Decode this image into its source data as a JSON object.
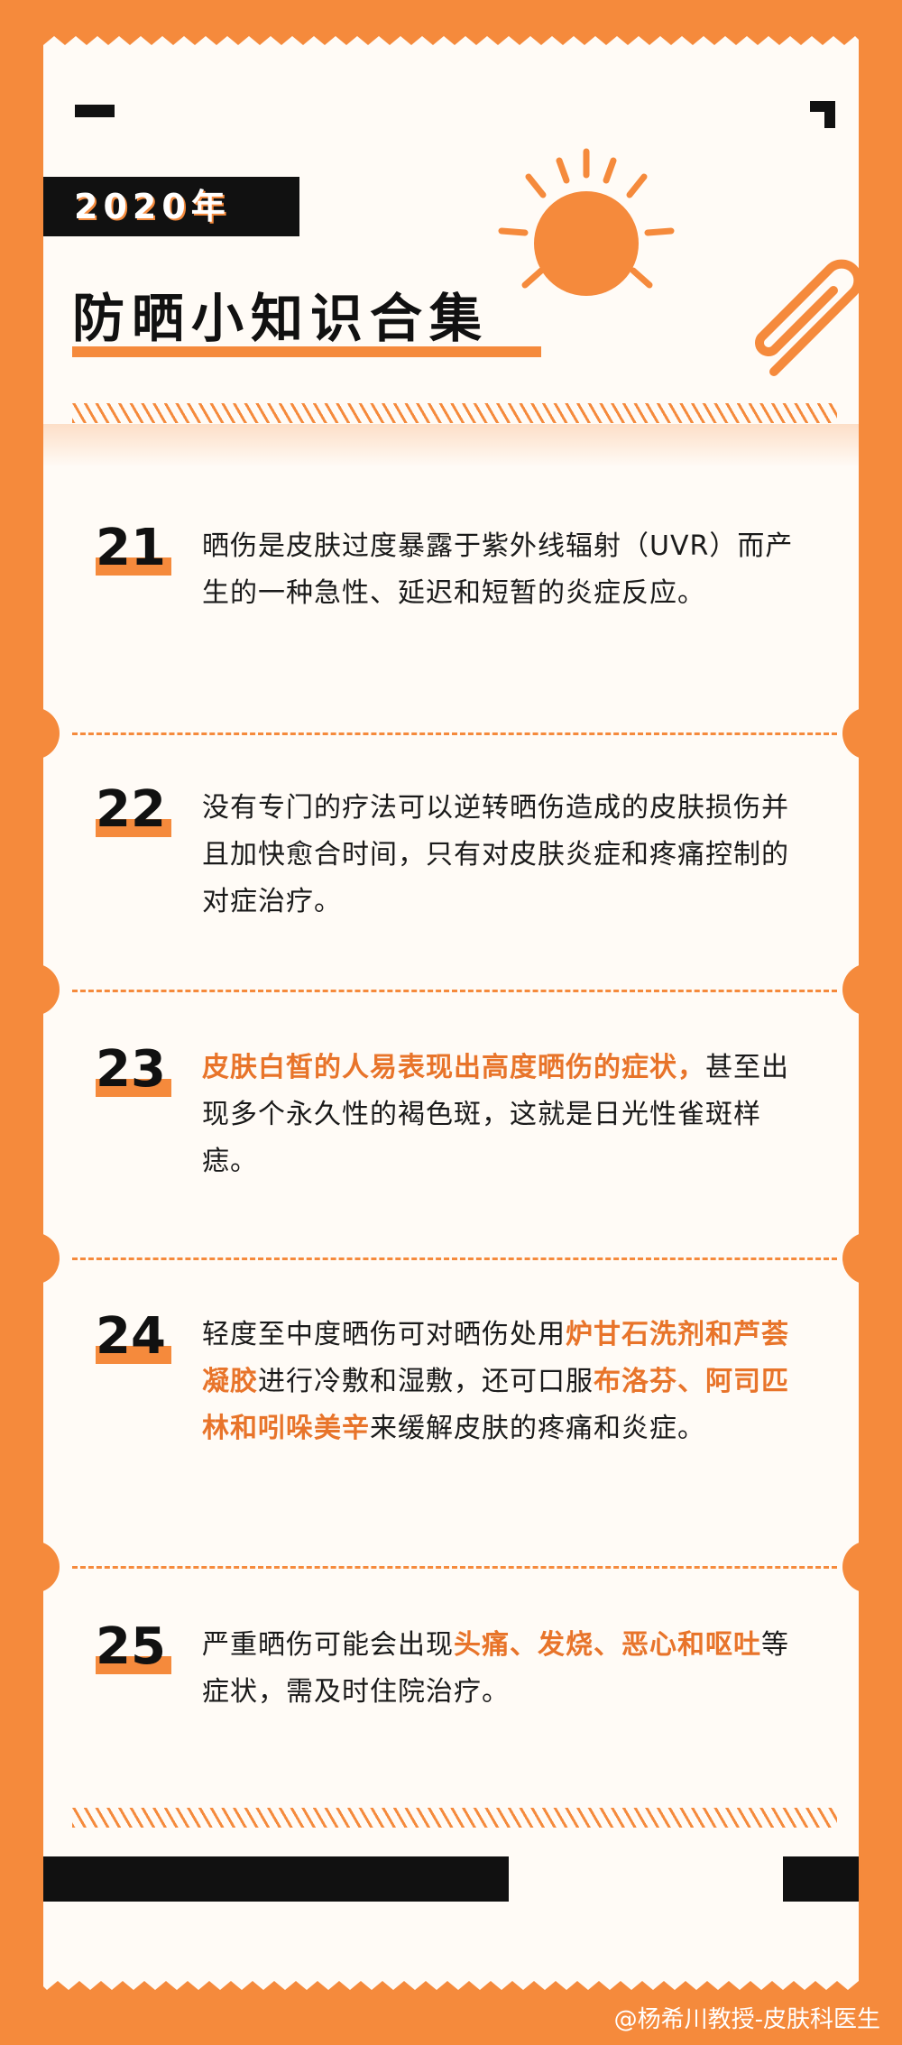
{
  "header": {
    "year": "2020年",
    "title": "防晒小知识合集"
  },
  "items": [
    {
      "number": "21",
      "segments": [
        {
          "text": "晒伤是皮肤过度暴露于紫外线辐射（UVR）而产生的一种急性、延迟和短暂的炎症反应。",
          "highlight": false
        }
      ]
    },
    {
      "number": "22",
      "segments": [
        {
          "text": "没有专门的疗法可以逆转晒伤造成的皮肤损伤并且加快愈合时间，只有对皮肤炎症和疼痛控制的对症治疗。",
          "highlight": false
        }
      ]
    },
    {
      "number": "23",
      "segments": [
        {
          "text": "皮肤白皙的人易表现出高度晒伤的症状，",
          "highlight": true
        },
        {
          "text": "甚至出现多个永久性的褐色斑，这就是日光性雀斑样痣。",
          "highlight": false
        }
      ]
    },
    {
      "number": "24",
      "segments": [
        {
          "text": "轻度至中度晒伤可对晒伤处用",
          "highlight": false
        },
        {
          "text": "炉甘石洗剂和芦荟凝胶",
          "highlight": true
        },
        {
          "text": "进行冷敷和湿敷，还可口服",
          "highlight": false
        },
        {
          "text": "布洛芬、阿司匹林和吲哚美辛",
          "highlight": true
        },
        {
          "text": "来缓解皮肤的疼痛和炎症。",
          "highlight": false
        }
      ]
    },
    {
      "number": "25",
      "segments": [
        {
          "text": "严重晒伤可能会出现",
          "highlight": false
        },
        {
          "text": "头痛、发烧、恶心和呕吐",
          "highlight": true
        },
        {
          "text": "等症状，需及时住院治疗。",
          "highlight": false
        }
      ]
    }
  ],
  "watermark": "@杨希川教授-皮肤科医生",
  "colors": {
    "accent": "#F58A3C",
    "highlight": "#E8742A",
    "ink": "#111111"
  }
}
